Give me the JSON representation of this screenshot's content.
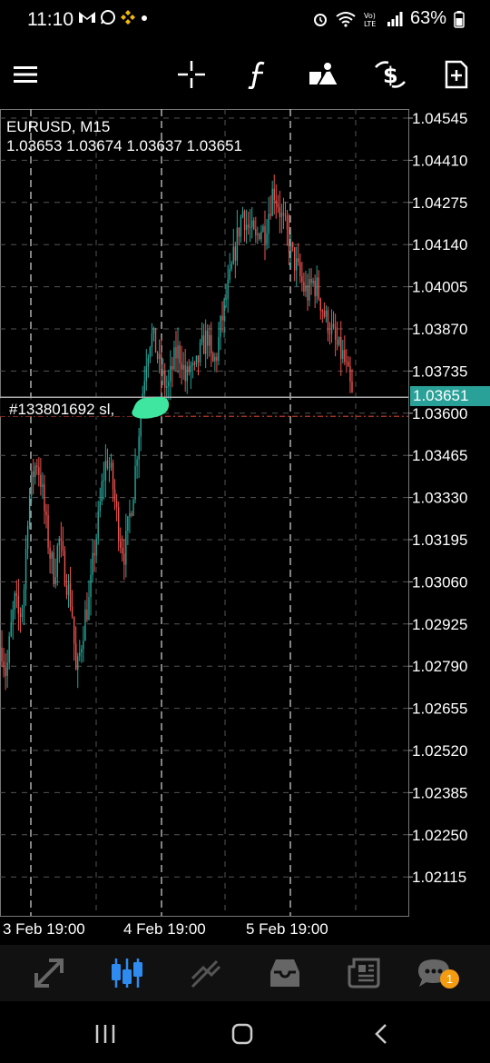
{
  "status_bar": {
    "time": "11:10",
    "battery": "63%",
    "left_icons": [
      "gmail-icon",
      "whatsapp-icon",
      "binance-icon",
      "dot-icon"
    ],
    "right_icons": [
      "alarm-icon",
      "wifi-icon",
      "volte-icon",
      "signal-icon",
      "battery-icon"
    ]
  },
  "toolbar": {
    "items": [
      "menu-icon",
      "crosshair-icon",
      "indicator-icon",
      "objects-icon",
      "dollar-exchange-icon",
      "new-order-icon"
    ]
  },
  "chart": {
    "symbol": "EURUSD, M15",
    "ohlc": "1.03653 1.03674 1.03637 1.03651",
    "order_label": "#133801692 sl,",
    "current_price": "1.03651",
    "colors": {
      "bull": "#26a69a",
      "bear": "#ef5350",
      "grid": "#555555",
      "order_line": "#c0392b",
      "price_line": "#aaaaaa",
      "badge": "#2aa198"
    }
  },
  "chart_data": {
    "type": "candlestick",
    "price_ticks": [
      "1.04545",
      "1.04410",
      "1.04275",
      "1.04140",
      "1.04005",
      "1.03870",
      "1.03735",
      "1.03600",
      "1.03465",
      "1.03330",
      "1.03195",
      "1.03060",
      "1.02925",
      "1.02790",
      "1.02655",
      "1.02520",
      "1.02385",
      "1.02250",
      "1.02115"
    ],
    "time_labels": [
      "3 Feb 19:00",
      "4 Feb 19:00",
      "5 Feb 19:00"
    ],
    "ylim": [
      1.0198,
      1.0454
    ],
    "current_price": 1.03651,
    "order_price": 1.0359,
    "grid": true,
    "close_path": [
      1.0285,
      1.0276,
      1.029,
      1.03,
      1.0294,
      1.0302,
      1.033,
      1.034,
      1.0345,
      1.0338,
      1.0325,
      1.0315,
      1.0308,
      1.032,
      1.0312,
      1.0305,
      1.0298,
      1.0275,
      1.0285,
      1.0295,
      1.03,
      1.0315,
      1.0325,
      1.0338,
      1.0346,
      1.034,
      1.033,
      1.032,
      1.0315,
      1.0325,
      1.0335,
      1.035,
      1.0365,
      1.0378,
      1.0385,
      1.0382,
      1.0375,
      1.037,
      1.0368,
      1.0375,
      1.038,
      1.0378,
      1.037,
      1.0375,
      1.0372,
      1.0378,
      1.0382,
      1.0385,
      1.0375,
      1.0378,
      1.0388,
      1.0395,
      1.0402,
      1.041,
      1.0418,
      1.0425,
      1.042,
      1.0418,
      1.0415,
      1.042,
      1.0418,
      1.0425,
      1.0432,
      1.0428,
      1.0422,
      1.0418,
      1.0412,
      1.0408,
      1.0404,
      1.04,
      1.0398,
      1.0402,
      1.04,
      1.0395,
      1.039,
      1.0388,
      1.0383,
      1.038,
      1.0378,
      1.0372,
      1.0365
    ]
  },
  "bottom_nav": {
    "items": [
      "quotes-icon",
      "chart-icon",
      "trade-icon",
      "history-icon",
      "news-icon",
      "chat-icon"
    ],
    "badge": "1"
  },
  "system_nav": {
    "items": [
      "recents-icon",
      "home-icon",
      "back-icon"
    ]
  }
}
